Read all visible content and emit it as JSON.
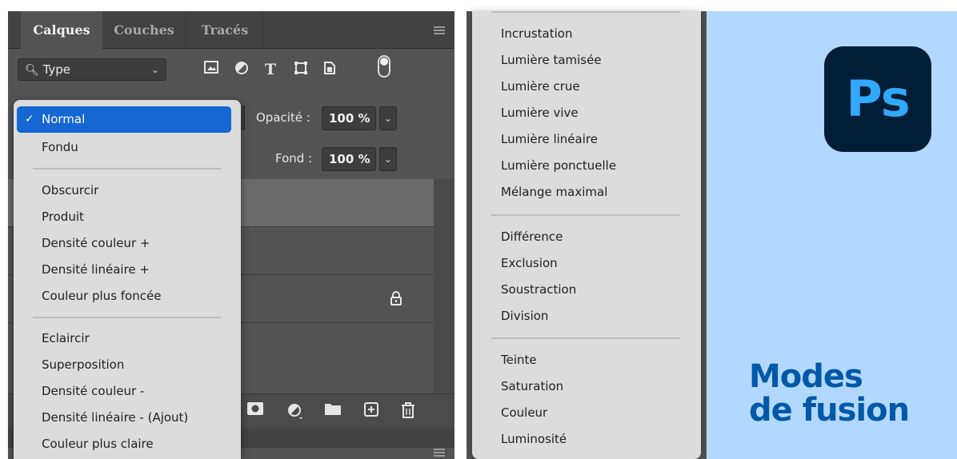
{
  "layers_panel": {
    "tabs": [
      {
        "label": "Calques",
        "active": true
      },
      {
        "label": "Couches",
        "active": false
      },
      {
        "label": "Tracés",
        "active": false
      }
    ],
    "filter": {
      "kind_icon": "search-icon",
      "kind_label": "Type",
      "icons": [
        "image-filter-icon",
        "adjustment-filter-icon",
        "text-filter-icon",
        "shape-filter-icon",
        "smart-object-filter-icon"
      ]
    },
    "opacity": {
      "label": "Opacité :",
      "value": "100 %"
    },
    "fill": {
      "label": "Fond :",
      "value": "100 %"
    },
    "bottom_icons": [
      "mask-icon",
      "adjustment-layer-icon",
      "folder-icon",
      "new-layer-icon",
      "trash-icon"
    ]
  },
  "blend_menu": {
    "items": [
      {
        "label": "Normal",
        "selected": true
      },
      {
        "label": "Fondu"
      },
      {
        "label": "Obscurcir"
      },
      {
        "label": "Produit"
      },
      {
        "label": "Densité couleur +"
      },
      {
        "label": "Densité linéaire +"
      },
      {
        "label": "Couleur plus foncée"
      },
      {
        "label": "Eclaircir"
      },
      {
        "label": "Superposition"
      },
      {
        "label": "Densité couleur -"
      },
      {
        "label": "Densité linéaire - (Ajout)"
      },
      {
        "label": "Couleur plus claire"
      }
    ]
  },
  "blend_menu_continued": {
    "items": [
      {
        "label": "Incrustation"
      },
      {
        "label": "Lumière tamisée"
      },
      {
        "label": "Lumière crue"
      },
      {
        "label": "Lumière vive"
      },
      {
        "label": "Lumière linéaire"
      },
      {
        "label": "Lumière ponctuelle"
      },
      {
        "label": "Mélange maximal"
      },
      {
        "label": "Différence"
      },
      {
        "label": "Exclusion"
      },
      {
        "label": "Soustraction"
      },
      {
        "label": "Division"
      },
      {
        "label": "Teinte"
      },
      {
        "label": "Saturation"
      },
      {
        "label": "Couleur"
      },
      {
        "label": "Luminosité"
      }
    ]
  },
  "promo": {
    "logo_text": "Ps",
    "title_line1": "Modes",
    "title_line2": "de fusion",
    "colors": {
      "background": "#b2d8ff",
      "title": "#0058a8",
      "logo_bg": "#001e36",
      "logo_text": "#31a8ff"
    }
  }
}
